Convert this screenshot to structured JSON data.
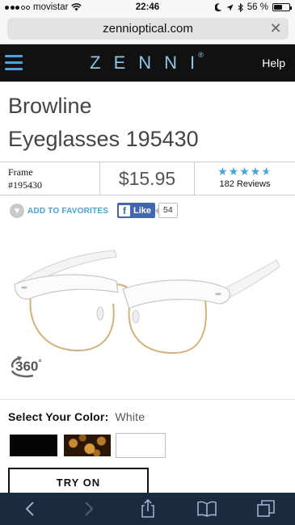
{
  "status_bar": {
    "carrier": "movistar",
    "time": "22:46",
    "battery_percent": "56 %",
    "battery_level": 0.56
  },
  "browser": {
    "url": "zennioptical.com",
    "clear_icon": "close-icon"
  },
  "header": {
    "logo": "ZENNI",
    "registered": "®",
    "help_label": "Help"
  },
  "product": {
    "title_line1": "Browline",
    "title_line2": "Eyeglasses 195430",
    "frame_label": "Frame",
    "frame_number": "#195430",
    "price": "$15.95",
    "rating": 4.5,
    "reviews": "182 Reviews"
  },
  "actions": {
    "favorites_label": "ADD TO FAVORITES",
    "like_label": "Like",
    "like_count": "54"
  },
  "viewer": {
    "rotate_label": "360",
    "degree": "°"
  },
  "color": {
    "label": "Select Your Color:",
    "selected": "White",
    "swatches": [
      "Black",
      "Tortoise",
      "White"
    ],
    "swatch_colors": [
      "#050505",
      "#5a3410",
      "#ffffff"
    ]
  },
  "try_on": {
    "label": "TRY ON"
  },
  "toolbar": {
    "icons": [
      "back-icon",
      "forward-icon",
      "share-icon",
      "bookmarks-icon",
      "tabs-icon"
    ]
  },
  "colors": {
    "accent": "#4aa0d6",
    "header_bg": "#111111",
    "toolbar_bg": "#1b2a3c",
    "facebook": "#4267b2"
  }
}
